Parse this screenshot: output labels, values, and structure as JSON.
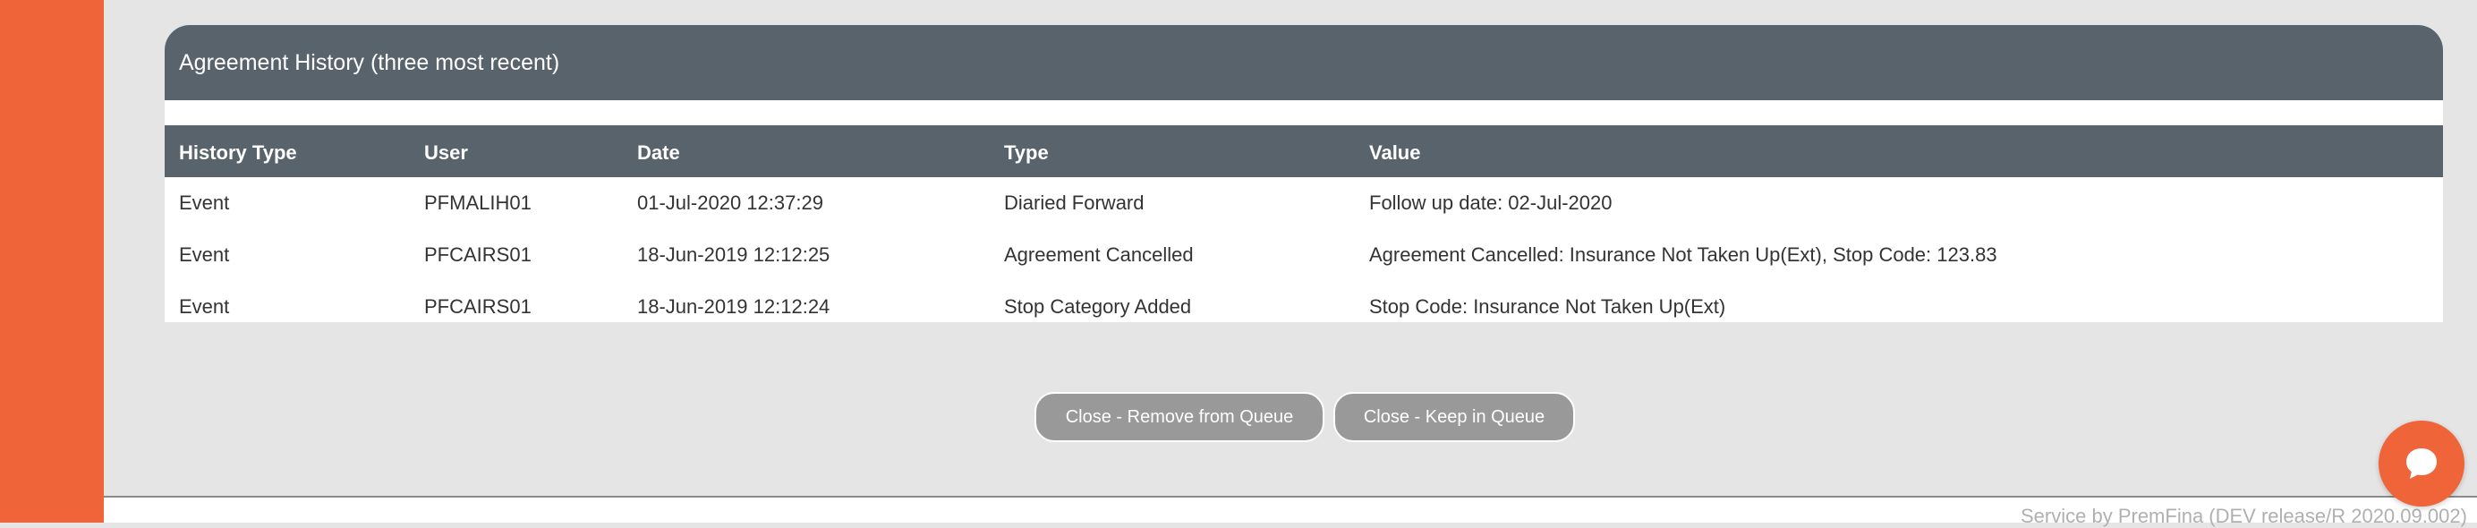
{
  "panel": {
    "title": "Agreement History (three most recent)"
  },
  "table": {
    "headers": [
      "History Type",
      "User",
      "Date",
      "Type",
      "Value"
    ],
    "rows": [
      [
        "Event",
        "PFMALIH01",
        "01-Jul-2020 12:37:29",
        "Diaried Forward",
        "Follow up date: 02-Jul-2020"
      ],
      [
        "Event",
        "PFCAIRS01",
        "18-Jun-2019 12:12:25",
        "Agreement Cancelled",
        "Agreement Cancelled: Insurance Not Taken Up(Ext), Stop Code: 123.83"
      ],
      [
        "Event",
        "PFCAIRS01",
        "18-Jun-2019 12:12:24",
        "Stop Category Added",
        "Stop Code: Insurance Not Taken Up(Ext)"
      ]
    ]
  },
  "buttons": {
    "close_remove": "Close - Remove from Queue",
    "close_keep": "Close - Keep in Queue"
  },
  "footer": {
    "text": "Service by PremFina (DEV release/R 2020.09.002)"
  },
  "colors": {
    "brand_orange": "#f0643a",
    "header_slate": "#58636b",
    "button_grey": "#999999"
  },
  "icons": {
    "chat": "chat-icon"
  }
}
